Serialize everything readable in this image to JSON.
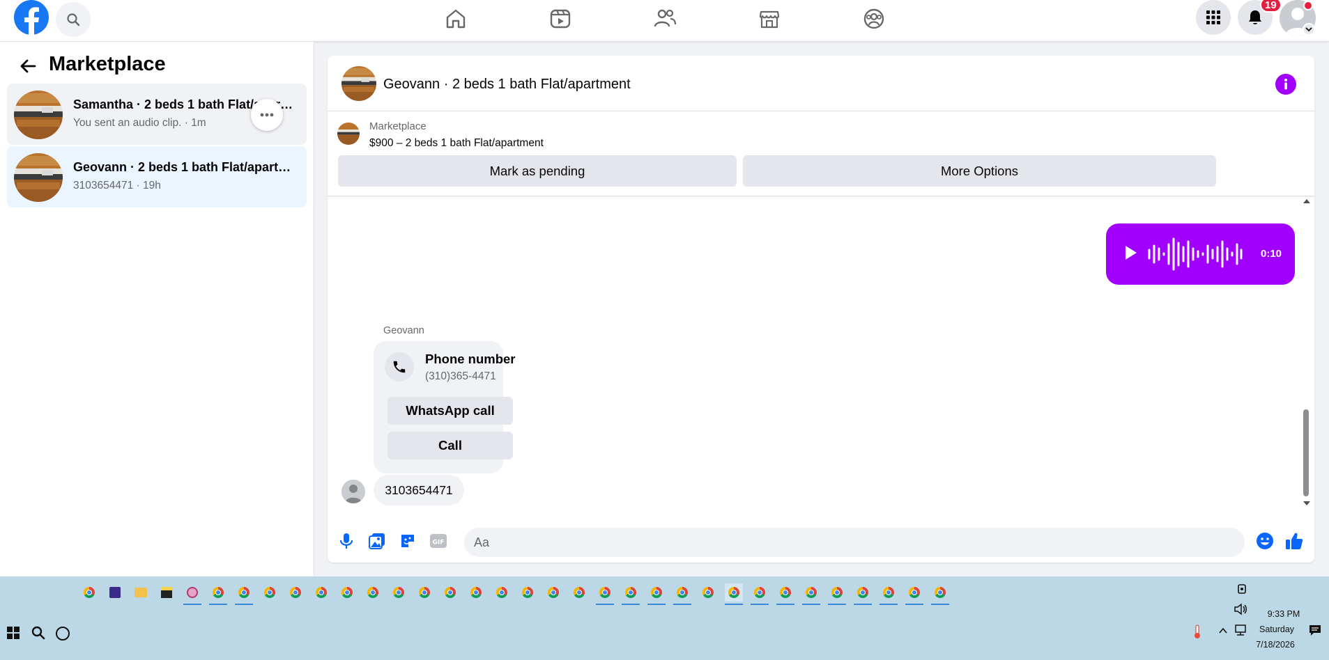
{
  "topnav": {
    "notifications_count": "19",
    "brand_color": "#1877f2"
  },
  "sidebar": {
    "title": "Marketplace",
    "conversations": [
      {
        "title": "Samantha · 2 beds 1 bath Flat/apartment",
        "subtitle": "You sent an audio clip. · 1m"
      },
      {
        "title": "Geovann · 2 beds 1 bath Flat/apartment",
        "subtitle": "3103654471 · 19h"
      }
    ]
  },
  "chat": {
    "header_title": "Geovann · 2 beds 1 bath Flat/apartment",
    "listing": {
      "category": "Marketplace",
      "price_title": "$900 – 2 beds 1 bath Flat/apartment",
      "mark_pending_label": "Mark as pending",
      "more_options_label": "More Options"
    },
    "audio_message": {
      "duration": "0:10",
      "color": "#a100ff"
    },
    "sender_name": "Geovann",
    "phone_card": {
      "title": "Phone number",
      "number": "(310)365-4471",
      "whatsapp_label": "WhatsApp call",
      "call_label": "Call"
    },
    "text_message": "3103654471",
    "composer": {
      "placeholder": "Aa"
    }
  },
  "taskbar": {
    "time": "9:33 PM",
    "day": "Saturday",
    "date": "7/18/2026"
  }
}
